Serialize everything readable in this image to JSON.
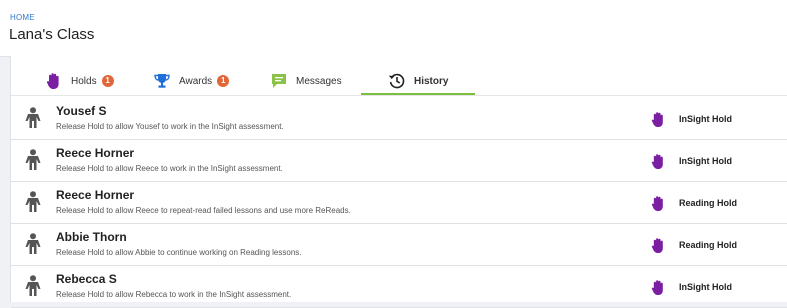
{
  "breadcrumb": "HOME",
  "page_title": "Lana's Class",
  "tabs": [
    {
      "label": "Holds",
      "badge": "1",
      "icon": "hand-icon"
    },
    {
      "label": "Awards",
      "badge": "1",
      "icon": "trophy-icon"
    },
    {
      "label": "Messages",
      "icon": "message-icon"
    },
    {
      "label": "History",
      "icon": "history-icon",
      "active": true
    }
  ],
  "colors": {
    "hold_icon": "#7b1fa2",
    "badge": "#e0673a",
    "active_tab_underline": "#7cbf3c",
    "breadcrumb": "#2f78c8"
  },
  "rows": [
    {
      "name": "Yousef S",
      "description": "Release Hold to allow Yousef to work in the InSight assessment.",
      "hold_type": "InSight Hold"
    },
    {
      "name": "Reece Horner",
      "description": "Release Hold to allow Reece to work in the InSight assessment.",
      "hold_type": "InSight Hold"
    },
    {
      "name": "Reece Horner",
      "description": "Release Hold to allow Reece to repeat-read failed lessons and use more ReReads.",
      "hold_type": "Reading Hold"
    },
    {
      "name": "Abbie Thorn",
      "description": "Release Hold to allow Abbie to continue working on Reading lessons.",
      "hold_type": "Reading Hold"
    },
    {
      "name": "Rebecca S",
      "description": "Release Hold to allow Rebecca to work in the InSight assessment.",
      "hold_type": "InSight Hold"
    }
  ]
}
